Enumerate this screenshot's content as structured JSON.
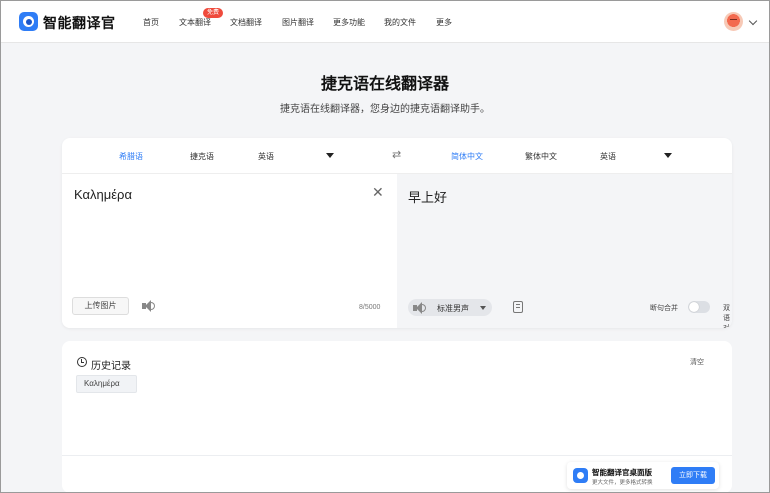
{
  "nav": {
    "brand": "智能翻译官",
    "items": [
      "首页",
      "文本翻译",
      "文档翻译",
      "图片翻译",
      "更多功能",
      "我的文件",
      "更多"
    ],
    "badge": "免费"
  },
  "hero": {
    "title": "捷克语在线翻译器",
    "subtitle": "捷克语在线翻译器，您身边的捷克语翻译助手。"
  },
  "translator": {
    "source_langs": [
      "希腊语",
      "捷克语",
      "英语"
    ],
    "target_langs": [
      "简体中文",
      "繁体中文",
      "英语"
    ],
    "active_source": "希腊语",
    "active_target": "简体中文",
    "source_text": "Καλημέρα",
    "target_text": "早上好",
    "upload_label": "上传图片",
    "char_count": "8/5000",
    "voice": "标准男声",
    "sentence_merge_label": "断句合并",
    "bilingual_label": "双语对照",
    "sentence_merge_on": false,
    "bilingual_on": false
  },
  "history": {
    "title": "历史记录",
    "clear_label": "清空",
    "items": [
      "Καλημέρα"
    ]
  },
  "promo": {
    "title": "智能翻译官桌面版",
    "subtitle": "更大文件，更多格式转换",
    "button": "立即下载"
  },
  "colors": {
    "accent": "#2f7df6",
    "badge": "#ef4a3c",
    "page_bg": "#f4f5f7"
  }
}
